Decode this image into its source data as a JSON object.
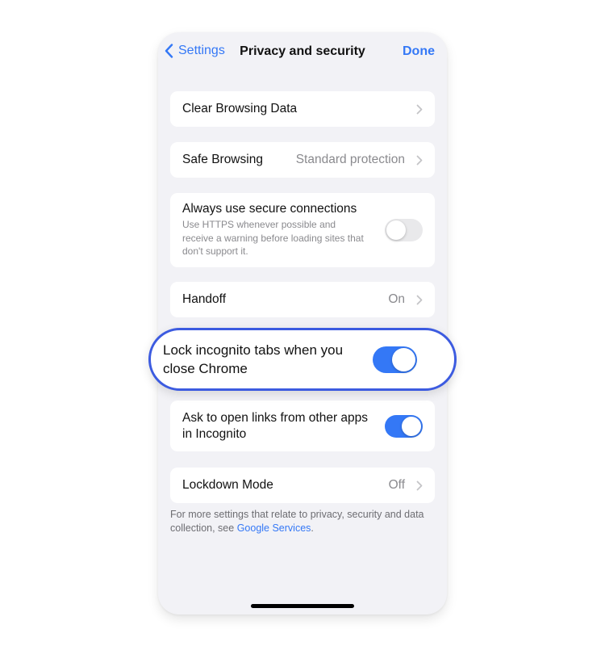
{
  "nav": {
    "back_label": "Settings",
    "title": "Privacy and security",
    "done_label": "Done"
  },
  "rows": {
    "clear_browsing": {
      "label": "Clear Browsing Data"
    },
    "safe_browsing": {
      "label": "Safe Browsing",
      "value": "Standard protection"
    },
    "secure_connections": {
      "label": "Always use secure connections",
      "description": "Use HTTPS whenever possible and receive a warning before loading sites that don't support it.",
      "enabled": false
    },
    "handoff": {
      "label": "Handoff",
      "value": "On"
    },
    "lock_incognito": {
      "label": "Lock incognito tabs when you close Chrome",
      "enabled": true
    },
    "ask_open_links": {
      "label": "Ask to open links from other apps in Incognito",
      "enabled": true
    },
    "lockdown": {
      "label": "Lockdown Mode",
      "value": "Off"
    }
  },
  "footer": {
    "text": "For more settings that relate to privacy, security and data collection, see ",
    "link": "Google Services",
    "suffix": "."
  },
  "colors": {
    "accent": "#3478f6",
    "highlight_border": "#3c5be0",
    "background": "#f2f2f6"
  }
}
